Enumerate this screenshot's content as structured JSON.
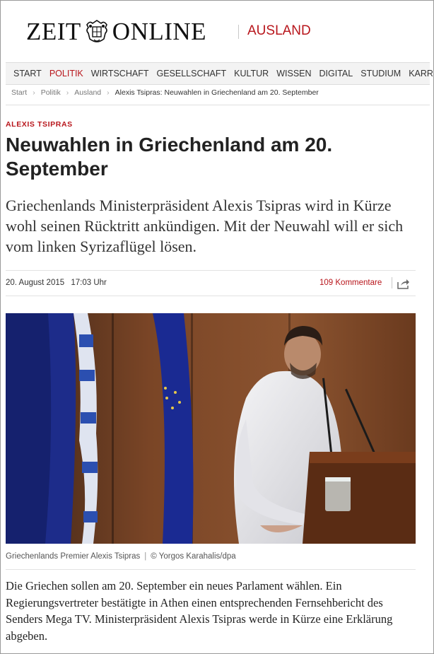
{
  "header": {
    "logo_left": "ZEIT",
    "logo_right": "ONLINE",
    "section": "AUSLAND"
  },
  "nav": {
    "items": [
      "START",
      "POLITIK",
      "WIRTSCHAFT",
      "GESELLSCHAFT",
      "KULTUR",
      "WISSEN",
      "DIGITAL",
      "STUDIUM",
      "KARRIERE"
    ],
    "active": "POLITIK"
  },
  "breadcrumb": {
    "items": [
      "Start",
      "Politik",
      "Ausland"
    ],
    "current": "Alexis Tsipras: Neuwahlen in Griechenland am 20. September",
    "separator": "›"
  },
  "article": {
    "kicker": "ALEXIS TSIPRAS",
    "headline": "Neuwahlen in Griechenland am 20. September",
    "lead": "Griechenlands Ministerpräsident Alexis Tsipras wird in Kürze wohl seinen Rücktritt ankündigen. Mit der Neuwahl will er sich vom linken Syrizaflügel lösen.",
    "date": "20. August 2015",
    "time": "17:03 Uhr",
    "comments": "109 Kommentare",
    "caption": "Griechenlands Premier Alexis Tsipras",
    "caption_sep": "|",
    "credit": "© Yorgos Karahalis/dpa",
    "body": "Die Griechen sollen am 20. September ein neues Parlament wählen. Ein Regierungsvertreter bestätigte in Athen einen entsprechenden Fernsehbericht des Senders Mega TV. Ministerpräsident Alexis Tsipras werde in Kürze eine Erklärung abgeben."
  },
  "colors": {
    "accent": "#b8161c",
    "nav_bg": "#f3f3f3"
  },
  "icons": {
    "crest": "eagle-crest-icon",
    "share": "share-icon"
  }
}
